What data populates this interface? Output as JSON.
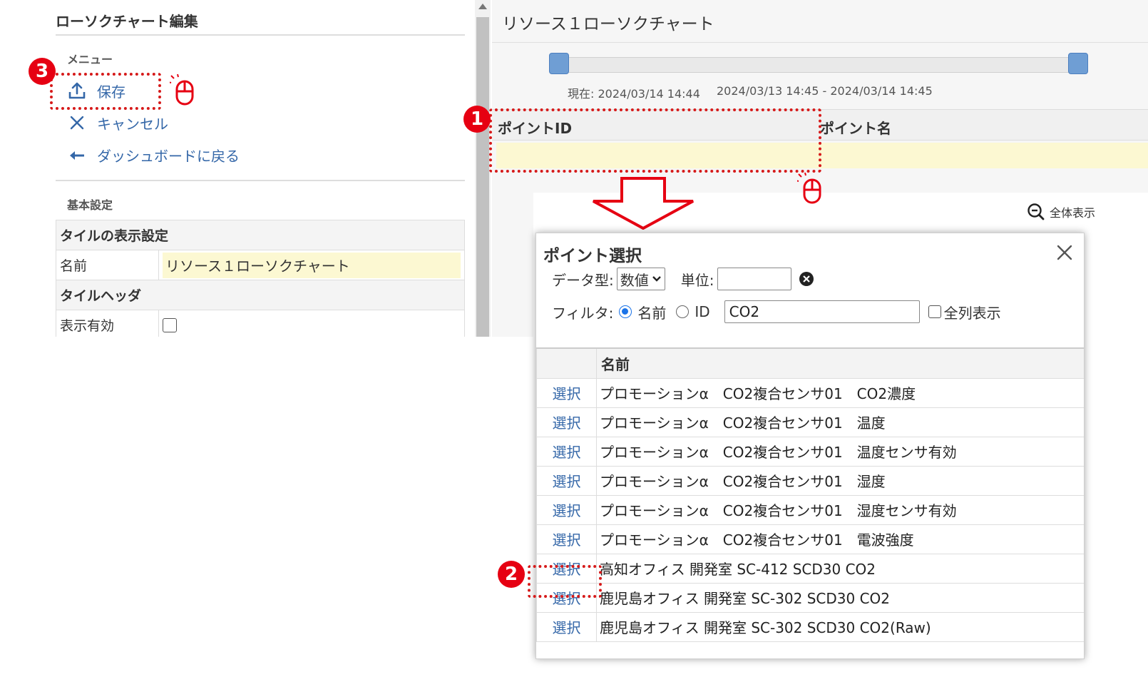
{
  "left_panel": {
    "title": "ローソクチャート編集",
    "menu_section": "メニュー",
    "menu": {
      "save": "保存",
      "cancel": "キャンセル",
      "back": "ダッシュボードに戻る"
    },
    "basic_section": "基本設定",
    "settings": {
      "tile_display": "タイルの表示設定",
      "name_label": "名前",
      "name_value": "リソース１ローソクチャート",
      "tile_header": "タイルヘッダ",
      "display_enabled_label": "表示有効"
    }
  },
  "chart_panel": {
    "title": "リソース１ローソクチャート",
    "current_label": "現在: 2024/03/14 14:44",
    "range_label": "2024/03/13 14:45 - 2024/03/14 14:45",
    "col_point_id": "ポイントID",
    "col_point_name": "ポイント名",
    "zoom_all": "全体表示"
  },
  "annotations": {
    "badge1": "1",
    "badge2": "2",
    "badge3": "3"
  },
  "dialog": {
    "title": "ポイント選択",
    "data_type_label": "データ型:",
    "data_type_value": "数値",
    "unit_label": "単位:",
    "filter_label": "フィルタ:",
    "filter_name": "名前",
    "filter_id": "ID",
    "filter_value": "CO2",
    "show_all_columns": "全列表示",
    "col_name": "名前",
    "rows": [
      {
        "select": "選択",
        "name": "プロモーションα　CO2複合センサ01　CO2濃度"
      },
      {
        "select": "選択",
        "name": "プロモーションα　CO2複合センサ01　温度"
      },
      {
        "select": "選択",
        "name": "プロモーションα　CO2複合センサ01　温度センサ有効"
      },
      {
        "select": "選択",
        "name": "プロモーションα　CO2複合センサ01　湿度"
      },
      {
        "select": "選択",
        "name": "プロモーションα　CO2複合センサ01　湿度センサ有効"
      },
      {
        "select": "選択",
        "name": "プロモーションα　CO2複合センサ01　電波強度"
      },
      {
        "select": "選択",
        "name": "高知オフィス 開発室 SC-412 SCD30 CO2"
      },
      {
        "select": "選択",
        "name": "鹿児島オフィス 開発室 SC-302 SCD30 CO2"
      },
      {
        "select": "選択",
        "name": "鹿児島オフィス 開発室 SC-302 SCD30 CO2(Raw)"
      }
    ]
  },
  "colors": {
    "accent_blue": "#3467a8",
    "annotation_red": "#e60012",
    "highlight_yellow": "#fcf8d2"
  }
}
